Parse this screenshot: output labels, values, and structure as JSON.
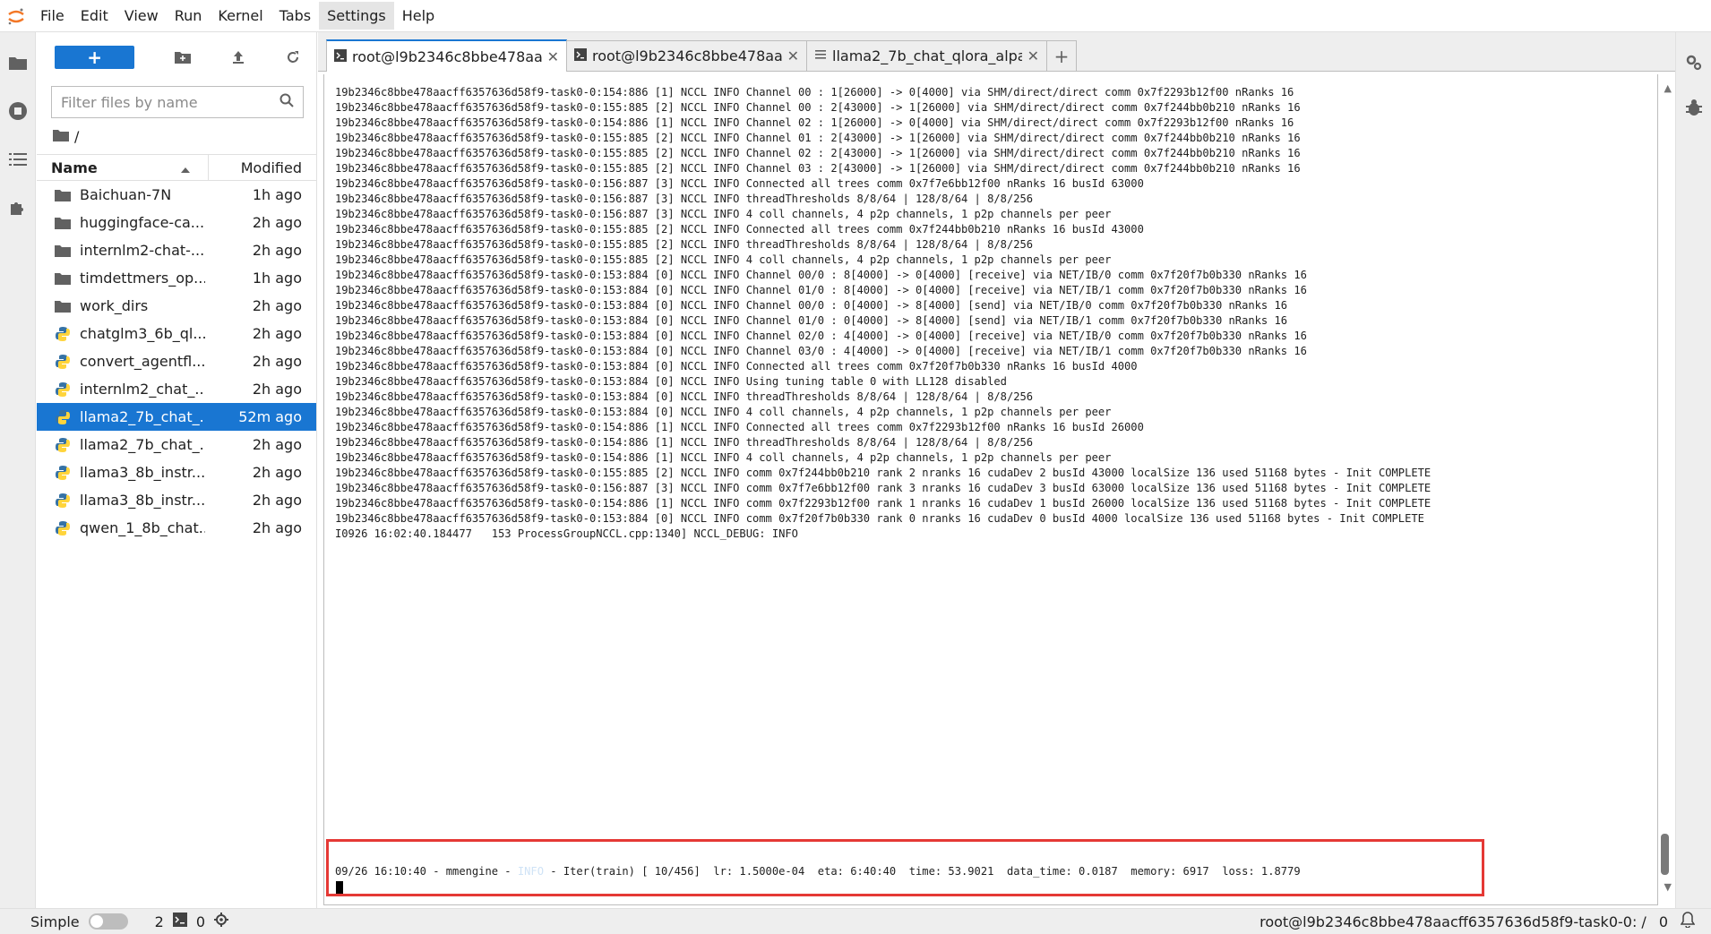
{
  "menu": [
    "File",
    "Edit",
    "View",
    "Run",
    "Kernel",
    "Tabs",
    "Settings",
    "Help"
  ],
  "menu_active": "Settings",
  "filebrowser": {
    "new_label": "+",
    "filter_placeholder": "Filter files by name",
    "breadcrumb": "/",
    "col_name": "Name",
    "col_modified": "Modified",
    "files": [
      {
        "name": "Baichuan-7N",
        "modified": "1h ago",
        "type": "folder"
      },
      {
        "name": "huggingface-ca...",
        "modified": "2h ago",
        "type": "folder"
      },
      {
        "name": "internlm2-chat-...",
        "modified": "2h ago",
        "type": "folder"
      },
      {
        "name": "timdettmers_op...",
        "modified": "1h ago",
        "type": "folder"
      },
      {
        "name": "work_dirs",
        "modified": "2h ago",
        "type": "folder"
      },
      {
        "name": "chatglm3_6b_ql...",
        "modified": "2h ago",
        "type": "python"
      },
      {
        "name": "convert_agentfl...",
        "modified": "2h ago",
        "type": "python"
      },
      {
        "name": "internlm2_chat_...",
        "modified": "2h ago",
        "type": "python"
      },
      {
        "name": "llama2_7b_chat_...",
        "modified": "52m ago",
        "type": "python",
        "selected": true
      },
      {
        "name": "llama2_7b_chat_...",
        "modified": "2h ago",
        "type": "python"
      },
      {
        "name": "llama3_8b_instr...",
        "modified": "2h ago",
        "type": "python"
      },
      {
        "name": "llama3_8b_instr...",
        "modified": "2h ago",
        "type": "python"
      },
      {
        "name": "qwen_1_8b_chat...",
        "modified": "2h ago",
        "type": "python"
      }
    ]
  },
  "tabs": [
    {
      "label": "root@l9b2346c8bbe478aa",
      "icon": "terminal-icon",
      "active": true
    },
    {
      "label": "root@l9b2346c8bbe478aa",
      "icon": "terminal-icon",
      "active": false
    },
    {
      "label": "llama2_7b_chat_qlora_alpa",
      "icon": "text-file-icon",
      "active": false
    }
  ],
  "terminal_lines": [
    "19b2346c8bbe478aacff6357636d58f9-task0-0:154:886 [1] NCCL INFO Channel 00 : 1[26000] -> 0[4000] via SHM/direct/direct comm 0x7f2293b12f00 nRanks 16",
    "19b2346c8bbe478aacff6357636d58f9-task0-0:155:885 [2] NCCL INFO Channel 00 : 2[43000] -> 1[26000] via SHM/direct/direct comm 0x7f244bb0b210 nRanks 16",
    "19b2346c8bbe478aacff6357636d58f9-task0-0:154:886 [1] NCCL INFO Channel 02 : 1[26000] -> 0[4000] via SHM/direct/direct comm 0x7f2293b12f00 nRanks 16",
    "19b2346c8bbe478aacff6357636d58f9-task0-0:155:885 [2] NCCL INFO Channel 01 : 2[43000] -> 1[26000] via SHM/direct/direct comm 0x7f244bb0b210 nRanks 16",
    "19b2346c8bbe478aacff6357636d58f9-task0-0:155:885 [2] NCCL INFO Channel 02 : 2[43000] -> 1[26000] via SHM/direct/direct comm 0x7f244bb0b210 nRanks 16",
    "19b2346c8bbe478aacff6357636d58f9-task0-0:155:885 [2] NCCL INFO Channel 03 : 2[43000] -> 1[26000] via SHM/direct/direct comm 0x7f244bb0b210 nRanks 16",
    "19b2346c8bbe478aacff6357636d58f9-task0-0:156:887 [3] NCCL INFO Connected all trees comm 0x7f7e6bb12f00 nRanks 16 busId 63000",
    "19b2346c8bbe478aacff6357636d58f9-task0-0:156:887 [3] NCCL INFO threadThresholds 8/8/64 | 128/8/64 | 8/8/256",
    "19b2346c8bbe478aacff6357636d58f9-task0-0:156:887 [3] NCCL INFO 4 coll channels, 4 p2p channels, 1 p2p channels per peer",
    "19b2346c8bbe478aacff6357636d58f9-task0-0:155:885 [2] NCCL INFO Connected all trees comm 0x7f244bb0b210 nRanks 16 busId 43000",
    "19b2346c8bbe478aacff6357636d58f9-task0-0:155:885 [2] NCCL INFO threadThresholds 8/8/64 | 128/8/64 | 8/8/256",
    "19b2346c8bbe478aacff6357636d58f9-task0-0:155:885 [2] NCCL INFO 4 coll channels, 4 p2p channels, 1 p2p channels per peer",
    "19b2346c8bbe478aacff6357636d58f9-task0-0:153:884 [0] NCCL INFO Channel 00/0 : 8[4000] -> 0[4000] [receive] via NET/IB/0 comm 0x7f20f7b0b330 nRanks 16",
    "19b2346c8bbe478aacff6357636d58f9-task0-0:153:884 [0] NCCL INFO Channel 01/0 : 8[4000] -> 0[4000] [receive] via NET/IB/1 comm 0x7f20f7b0b330 nRanks 16",
    "19b2346c8bbe478aacff6357636d58f9-task0-0:153:884 [0] NCCL INFO Channel 00/0 : 0[4000] -> 8[4000] [send] via NET/IB/0 comm 0x7f20f7b0b330 nRanks 16",
    "19b2346c8bbe478aacff6357636d58f9-task0-0:153:884 [0] NCCL INFO Channel 01/0 : 0[4000] -> 8[4000] [send] via NET/IB/1 comm 0x7f20f7b0b330 nRanks 16",
    "19b2346c8bbe478aacff6357636d58f9-task0-0:153:884 [0] NCCL INFO Channel 02/0 : 4[4000] -> 0[4000] [receive] via NET/IB/0 comm 0x7f20f7b0b330 nRanks 16",
    "19b2346c8bbe478aacff6357636d58f9-task0-0:153:884 [0] NCCL INFO Channel 03/0 : 4[4000] -> 0[4000] [receive] via NET/IB/1 comm 0x7f20f7b0b330 nRanks 16",
    "19b2346c8bbe478aacff6357636d58f9-task0-0:153:884 [0] NCCL INFO Connected all trees comm 0x7f20f7b0b330 nRanks 16 busId 4000",
    "19b2346c8bbe478aacff6357636d58f9-task0-0:153:884 [0] NCCL INFO Using tuning table 0 with LL128 disabled",
    "19b2346c8bbe478aacff6357636d58f9-task0-0:153:884 [0] NCCL INFO threadThresholds 8/8/64 | 128/8/64 | 8/8/256",
    "19b2346c8bbe478aacff6357636d58f9-task0-0:153:884 [0] NCCL INFO 4 coll channels, 4 p2p channels, 1 p2p channels per peer",
    "19b2346c8bbe478aacff6357636d58f9-task0-0:154:886 [1] NCCL INFO Connected all trees comm 0x7f2293b12f00 nRanks 16 busId 26000",
    "19b2346c8bbe478aacff6357636d58f9-task0-0:154:886 [1] NCCL INFO threadThresholds 8/8/64 | 128/8/64 | 8/8/256",
    "19b2346c8bbe478aacff6357636d58f9-task0-0:154:886 [1] NCCL INFO 4 coll channels, 4 p2p channels, 1 p2p channels per peer",
    "19b2346c8bbe478aacff6357636d58f9-task0-0:155:885 [2] NCCL INFO comm 0x7f244bb0b210 rank 2 nranks 16 cudaDev 2 busId 43000 localSize 136 used 51168 bytes - Init COMPLETE",
    "19b2346c8bbe478aacff6357636d58f9-task0-0:156:887 [3] NCCL INFO comm 0x7f7e6bb12f00 rank 3 nranks 16 cudaDev 3 busId 63000 localSize 136 used 51168 bytes - Init COMPLETE",
    "19b2346c8bbe478aacff6357636d58f9-task0-0:154:886 [1] NCCL INFO comm 0x7f2293b12f00 rank 1 nranks 16 cudaDev 1 busId 26000 localSize 136 used 51168 bytes - Init COMPLETE",
    "19b2346c8bbe478aacff6357636d58f9-task0-0:153:884 [0] NCCL INFO comm 0x7f20f7b0b330 rank 0 nranks 16 cudaDev 0 busId 4000 localSize 136 used 51168 bytes - Init COMPLETE",
    "I0926 16:02:40.184477   153 ProcessGroupNCCL.cpp:1340] NCCL_DEBUG: INFO"
  ],
  "log_line": {
    "prefix": "09/26 16:10:40 - mmengine - ",
    "level": "INFO",
    "suffix": " - Iter(train) [ 10/456]  lr: 1.5000e-04  eta: 6:40:40  time: 53.9021  data_time: 0.0187  memory: 6917  loss: 1.8779"
  },
  "status": {
    "mode_label": "Simple",
    "terminals_count": "2",
    "kernels_count": "0",
    "terminal_title": "root@l9b2346c8bbe478aacff6357636d58f9-task0-0: /",
    "right_count": "0"
  },
  "colors": {
    "accent": "#1976d2",
    "highlight": "#e53935"
  }
}
